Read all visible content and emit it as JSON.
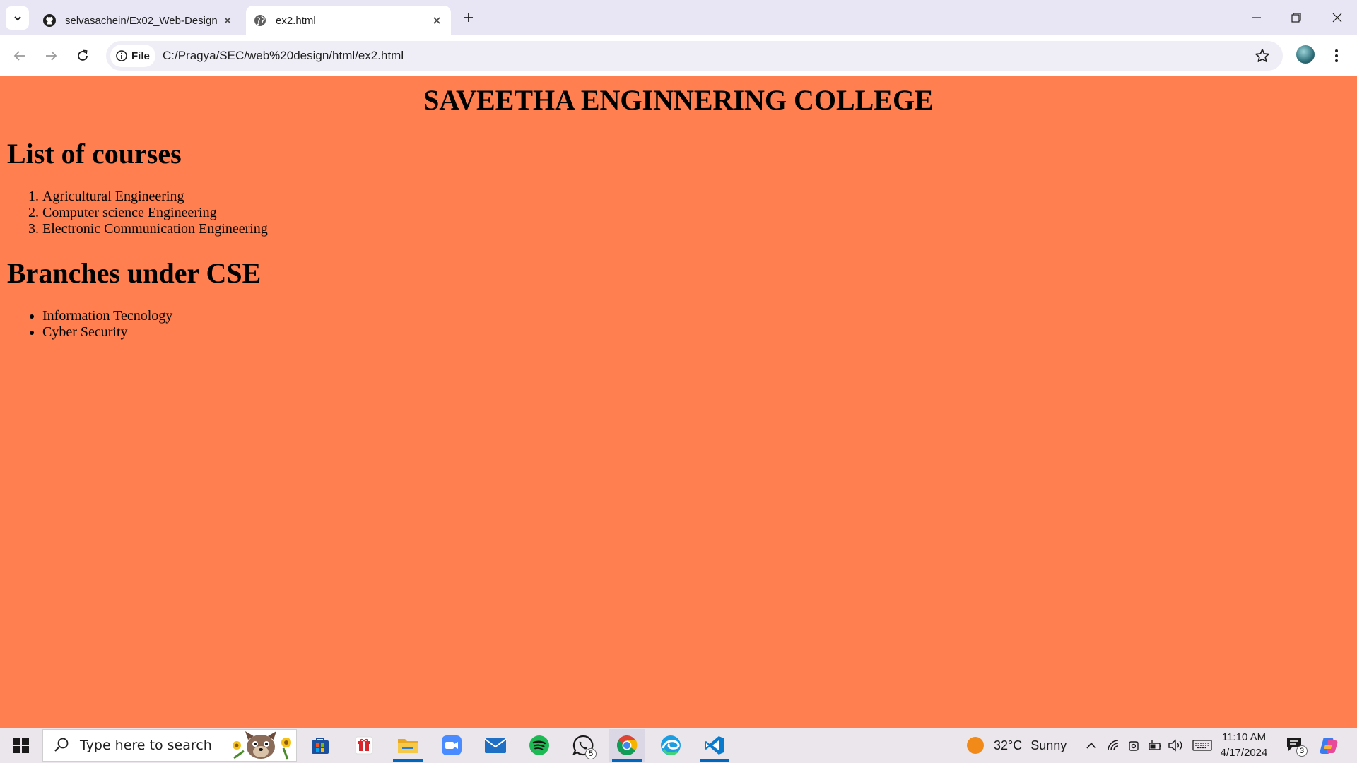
{
  "browser": {
    "tabs": [
      {
        "title": "selvasachein/Ex02_Web-Design",
        "favicon": "github-icon",
        "active": false
      },
      {
        "title": "ex2.html",
        "favicon": "globe-icon",
        "active": true
      }
    ],
    "address_chip": "File",
    "url": "C:/Pragya/SEC/web%20design/html/ex2.html"
  },
  "page": {
    "background": "#ff7f50",
    "college_title": "SAVEETHA ENGINNERING COLLEGE",
    "courses_heading": "List of courses",
    "courses": [
      "Agricultural Engineering",
      "Computer science Engineering",
      "Electronic Communication Engineering"
    ],
    "branches_heading": "Branches under CSE",
    "branches": [
      "Information Tecnology",
      "Cyber Security"
    ]
  },
  "taskbar": {
    "search_placeholder": "Type here to search",
    "whatsapp_badge": "5",
    "weather_temp": "32°C",
    "weather_text": "Sunny",
    "time": "11:10 AM",
    "date": "4/17/2024",
    "notification_count": "3",
    "accent": "#0067c0"
  }
}
